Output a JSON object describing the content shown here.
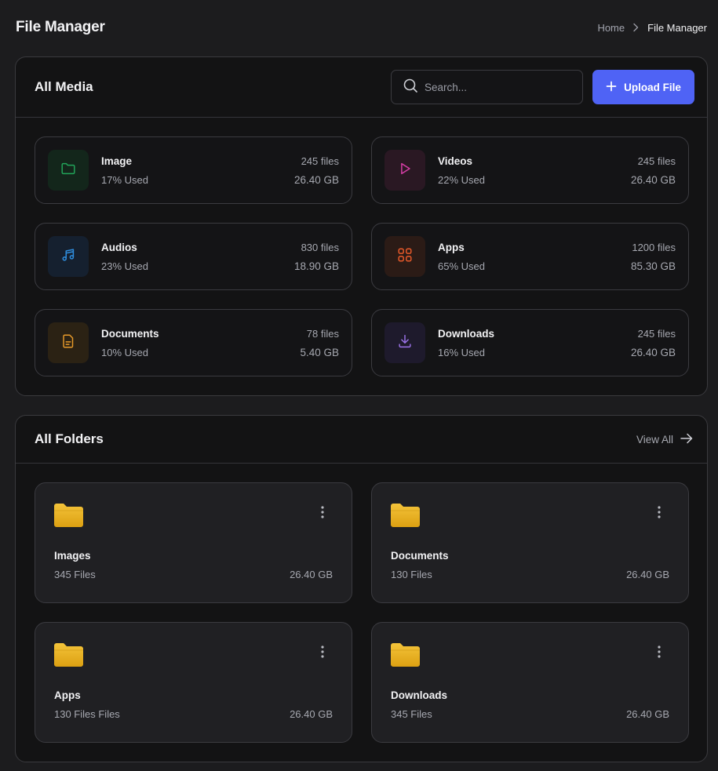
{
  "page": {
    "title": "File Manager",
    "breadcrumb": {
      "home": "Home",
      "current": "File Manager"
    }
  },
  "media": {
    "title": "All Media",
    "search_placeholder": "Search...",
    "upload_label": "Upload File",
    "items": [
      {
        "name": "Image",
        "used": "17% Used",
        "files": "245 files",
        "size": "26.40 GB",
        "icon": "folder-icon",
        "color": "#22a55a",
        "bg": "#13261b"
      },
      {
        "name": "Videos",
        "used": "22% Used",
        "files": "245 files",
        "size": "26.40 GB",
        "icon": "play-icon",
        "color": "#d63ea6",
        "bg": "#2a1823"
      },
      {
        "name": "Audios",
        "used": "23% Used",
        "files": "830 files",
        "size": "18.90 GB",
        "icon": "music-icon",
        "color": "#2f8fe0",
        "bg": "#15202f"
      },
      {
        "name": "Apps",
        "used": "65% Used",
        "files": "1200 files",
        "size": "85.30 GB",
        "icon": "grid-icon",
        "color": "#ea5a2a",
        "bg": "#2b1b16"
      },
      {
        "name": "Documents",
        "used": "10% Used",
        "files": "78 files",
        "size": "5.40 GB",
        "icon": "document-icon",
        "color": "#e79a2a",
        "bg": "#2b2214"
      },
      {
        "name": "Downloads",
        "used": "16% Used",
        "files": "245 files",
        "size": "26.40 GB",
        "icon": "download-icon",
        "color": "#9a72e8",
        "bg": "#1e1a2c"
      }
    ]
  },
  "folders": {
    "title": "All Folders",
    "view_all": "View All",
    "folder_color": "#e9b31c",
    "items": [
      {
        "name": "Images",
        "count": "345 Files",
        "size": "26.40 GB"
      },
      {
        "name": "Documents",
        "count": "130 Files",
        "size": "26.40 GB"
      },
      {
        "name": "Apps",
        "count": "130 Files Files",
        "size": "26.40 GB"
      },
      {
        "name": "Downloads",
        "count": "345 Files",
        "size": "26.40 GB"
      }
    ]
  }
}
